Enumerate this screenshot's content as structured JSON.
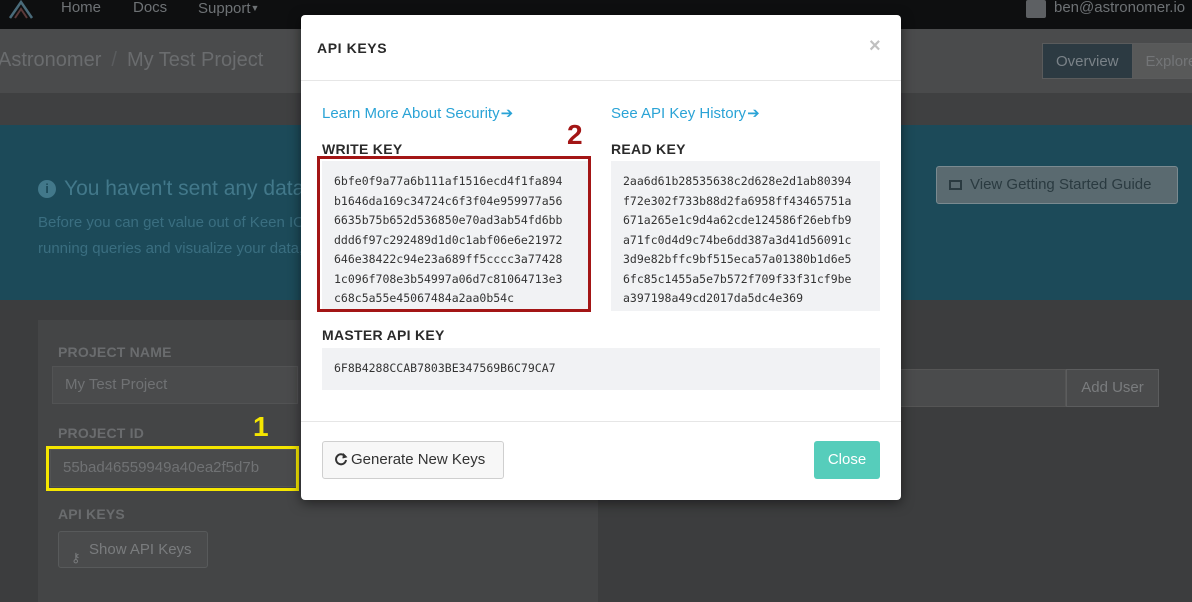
{
  "nav": {
    "items": [
      "Home",
      "Docs",
      "Support"
    ],
    "user_email": "ben@astronomer.io"
  },
  "breadcrumb": {
    "org": "Astronomer",
    "separator": "/",
    "project": "My Test Project"
  },
  "tabs": [
    "Overview",
    "Explorer"
  ],
  "hero": {
    "title": "You haven't sent any data yet!",
    "line1": "Before you can get value out of Keen IO,",
    "line2": "running queries and visualize your data,",
    "guide_button": "View Getting Started Guide"
  },
  "project": {
    "name_label": "PROJECT NAME",
    "name_value": "My Test Project",
    "id_label": "PROJECT ID",
    "id_value": "55bad46559949a40ea2f5d7b",
    "api_keys_label": "API KEYS",
    "show_keys_button": "Show API Keys",
    "add_user_button": "Add User"
  },
  "annotations": {
    "one": "1",
    "two": "2",
    "yellow": "#f5e600",
    "red": "#a31515"
  },
  "modal": {
    "title": "API KEYS",
    "close_x": "×",
    "security_link": "Learn More About Security",
    "history_link": "See API Key History",
    "link_arrow": "➔",
    "write_key_label": "WRITE KEY",
    "write_key_lines": [
      "6bfe0f9a77a6b111af1516ecd4f1fa894",
      "b1646da169c34724c6f3f04e959977a56",
      "6635b75b652d536850e70ad3ab54fd6bb",
      "ddd6f97c292489d1d0c1abf06e6e21972",
      "646e38422c94e23a689ff5cccc3a77428",
      "1c096f708e3b54997a06d7c81064713e3",
      "c68c5a55e45067484a2aa0b54c"
    ],
    "read_key_label": "READ KEY",
    "read_key_lines": [
      "2aa6d61b28535638c2d628e2d1ab80394",
      "f72e302f733b88d2fa6958ff43465751a",
      "671a265e1c9d4a62cde124586f26ebfb9",
      "a71fc0d4d9c74be6dd387a3d41d56091c",
      "3d9e82bffc9bf515eca57a01380b1d6e5",
      "6fc85c1455a5e7b572f709f33f31cf9be",
      "a397198a49cd2017da5dc4e369"
    ],
    "master_key_label": "MASTER API KEY",
    "master_key_value": "6F8B4288CCAB7803BE347569B6C79CA7",
    "generate_button": "Generate New Keys",
    "close_button": "Close",
    "accent_color": "#56cdbb",
    "link_color": "#2aa3d6"
  }
}
